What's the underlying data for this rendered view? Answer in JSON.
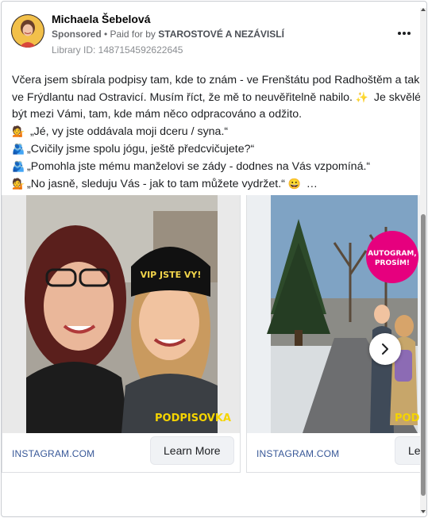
{
  "post": {
    "author_name": "Michaela Šebelová",
    "sponsored_label": "Sponsored",
    "paid_for_prefix": " • Paid for by ",
    "payer": "STAROSTOVÉ A NEZÁVISLÍ",
    "library_id": "Library ID: 1487154592622645",
    "more_icon": "more-horizontal-icon",
    "body_lines": [
      "Včera jsem sbírala podpisy tam, kde to znám - ve Frenštátu pod Radhoštěm a také",
      "ve Frýdlantu nad Ostravicí. Musím říct, že mě to neuvěřitelně nabilo.",
      " Je skvělé",
      "být mezi Vámi, tam, kde mám něco odpracováno a odžito."
    ],
    "quotes": [
      " „Jé, vy jste oddávala moji dceru / syna.“",
      "„Cvičily jsme spolu jógu, ještě předcvičujete?“",
      "„Pomohla jste mému manželovi se zády - dodnes na Vás vzpomíná.“",
      "„No jasně, sleduju Vás - jak to tam můžete vydržet.“"
    ],
    "ellipsis": " …"
  },
  "carousel": {
    "cards": [
      {
        "link": "INSTAGRAM.COM",
        "cta": "Learn More",
        "hat_text": "VIP JSTE VY!",
        "sticker_text": "PODPISOVKA"
      },
      {
        "link": "INSTAGRAM.COM",
        "cta": "Learn More",
        "badge_line1": "AUTOGRAM,",
        "badge_line2": "PROSÍM!",
        "sticker_text": "PODPISOVKA"
      }
    ],
    "next_icon": "chevron-right-icon"
  },
  "colors": {
    "link": "#385898",
    "badge": "#e6007e",
    "sticker": "#f5d400"
  }
}
